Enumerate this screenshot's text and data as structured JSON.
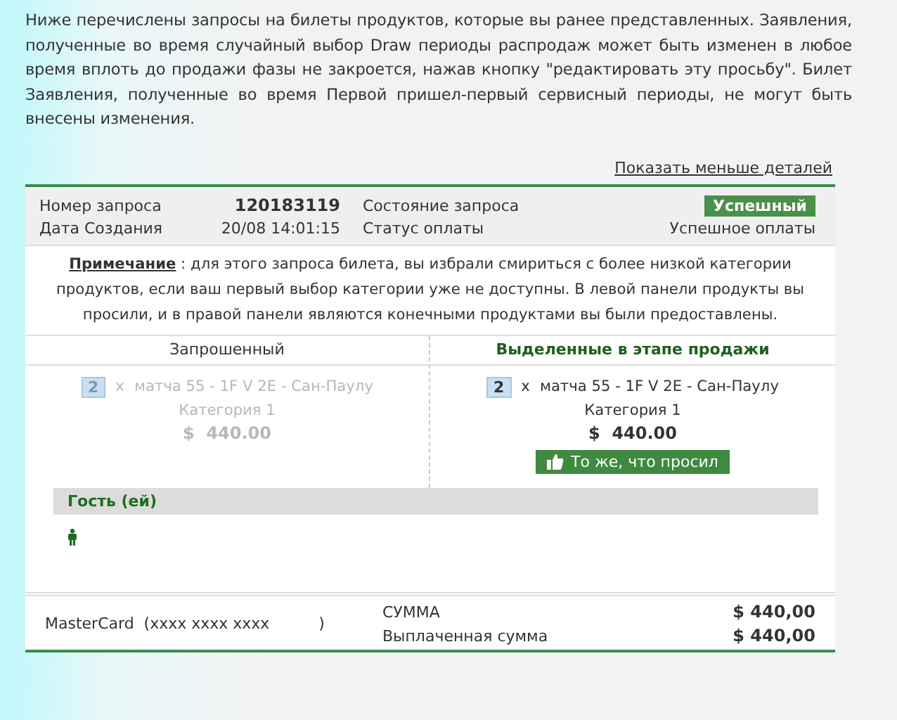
{
  "intro": "Ниже перечислены запросы на билеты продуктов, которые вы ранее представленных. Заявления, полученные во время случайный выбор Draw периоды распродаж может быть изменен в любое время вплоть до продажи фазы не закроется, нажав кнопку \"редактировать эту просьбу\". Билет Заявления, полученные во время Первой пришел-первый сервисный периоды, не могут быть внесены изменения.",
  "details_link": "Показать меньше деталей",
  "summary": {
    "rows": [
      {
        "label": "Номер запроса",
        "value": "120183119",
        "state_label": "Состояние запроса",
        "state_value": "Успешный",
        "kind": "badge"
      },
      {
        "label": "Дата Создания",
        "value": "20/08 14:01:15",
        "state_label": "Статус оплаты",
        "state_value": "Успешное оплаты",
        "kind": "text"
      }
    ]
  },
  "note": "**Примечание** : для этого запроса билета, вы избрали смириться с более низкой категории продуктов, если ваш первый выбор категории уже не доступны. В левой панели продукты вы просили, и в правой панели являются конечными продуктами вы были предоставлены.",
  "columns": [
    {
      "heading": "Запрошенный",
      "highlighted": false,
      "greyed": true,
      "quantity": "2",
      "times": "x",
      "product": "матча 55 - 1F V 2E - Сан-Паулу",
      "category": "Категория 1",
      "price": "$  440.00"
    },
    {
      "heading": "Выделенные в этапе продажи",
      "highlighted": true,
      "greyed": false,
      "quantity": "2",
      "times": "x",
      "product": "матча 55 - 1F V 2E - Сан-Паулу",
      "category": "Категория 1",
      "price": "$  440.00",
      "confirmation": "То же, что просил"
    }
  ],
  "guests": {
    "title": "Гость (ей)"
  },
  "payment": {
    "card": "MasterCard",
    "card_number": "(xxxx xxxx xxxx",
    "card_close": ")",
    "rows": [
      {
        "label": "СУММА",
        "value": "$  440,00"
      },
      {
        "label": "Выплаченная сумма",
        "value": "$  440,00"
      }
    ]
  }
}
